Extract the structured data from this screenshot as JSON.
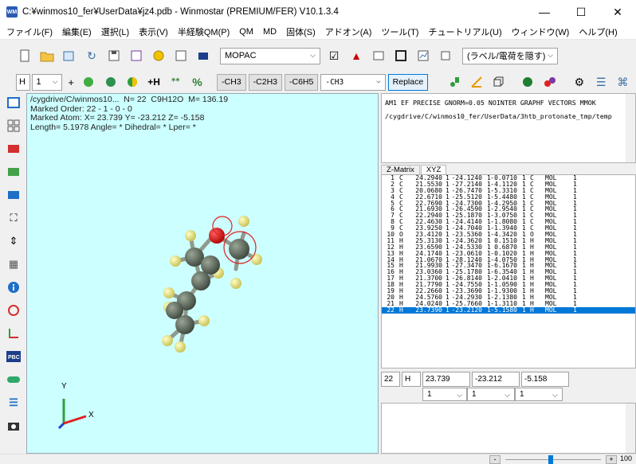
{
  "window": {
    "title": "C:¥winmos10_fer¥UserData¥jz4.pdb - Winmostar (PREMIUM/FER) V10.1.3.4",
    "logo": "WM",
    "minimize": "—",
    "maximize": "☐",
    "close": "✕"
  },
  "menu": [
    "ファイル(F)",
    "編集(E)",
    "選択(L)",
    "表示(V)",
    "半経験QM(P)",
    "QM",
    "MD",
    "固体(S)",
    "アドオン(A)",
    "ツール(T)",
    "チュートリアル(U)",
    "ウィンドウ(W)",
    "ヘルプ(H)"
  ],
  "toolbar1": {
    "method_select": "MOPAC",
    "label_select": "(ラベル/電荷を隠す)"
  },
  "toolbar2": {
    "element_select": "H",
    "count_select": "1",
    "plus_label": "+",
    "h_label": "+H",
    "percent_label": "%",
    "btn_ch3": "-CH3",
    "btn_c2h3": "-C2H3",
    "btn_c6h5": "-C6H5",
    "fragment_select": "-CH3",
    "replace_button": "Replace"
  },
  "viewer": {
    "line1": "/cygdrive/C/winmos10...  N= 22  C9H12O  M= 136.19",
    "line2": "Marked Order: 22 - 1 - 0 - 0",
    "line3": "Marked Atom: X= 23.739 Y= -23.212 Z= -5.158",
    "line4": "Length= 5.1978 Angle= * Dihedral= * Lper= *",
    "axis_y": "Y",
    "axis_x": "X"
  },
  "keywords": {
    "line1": "AM1 EF PRECISE GNORM=0.05 NOINTER GRAPHF VECTORS MMOK",
    "line2": "/cygdrive/C/winmos10_fer/UserData/3htb_protonate_tmp/temp"
  },
  "tabs": [
    "Z-Matrix",
    "XYZ"
  ],
  "xyz_rows": [
    [
      "1",
      "C",
      "24.2940",
      "1",
      "-24.1240",
      "1",
      "-0.0710",
      "1",
      "C",
      "MOL",
      "1"
    ],
    [
      "2",
      "C",
      "21.5530",
      "1",
      "-27.2140",
      "1",
      "-4.1120",
      "1",
      "C",
      "MOL",
      "1"
    ],
    [
      "3",
      "C",
      "20.0680",
      "1",
      "-26.7470",
      "1",
      "-5.3310",
      "1",
      "C",
      "MOL",
      "1"
    ],
    [
      "4",
      "C",
      "22.6710",
      "1",
      "-25.5120",
      "1",
      "-5.4480",
      "1",
      "C",
      "MOL",
      "1"
    ],
    [
      "5",
      "C",
      "22.7690",
      "1",
      "-24.7300",
      "1",
      "-4.2950",
      "1",
      "C",
      "MOL",
      "1"
    ],
    [
      "6",
      "C",
      "21.6930",
      "1",
      "-26.4590",
      "1",
      "-2.9540",
      "1",
      "C",
      "MOL",
      "1"
    ],
    [
      "7",
      "C",
      "22.2940",
      "1",
      "-25.1870",
      "1",
      "-3.0750",
      "1",
      "C",
      "MOL",
      "1"
    ],
    [
      "8",
      "C",
      "22.4630",
      "1",
      "-24.4140",
      "1",
      "-1.8080",
      "1",
      "C",
      "MOL",
      "1"
    ],
    [
      "9",
      "C",
      "23.9250",
      "1",
      "-24.7040",
      "1",
      "-1.3940",
      "1",
      "C",
      "MOL",
      "1"
    ],
    [
      "10",
      "O",
      "23.4120",
      "1",
      "-23.5360",
      "1",
      "-4.3420",
      "1",
      "O",
      "MOL",
      "1"
    ],
    [
      "11",
      "H",
      "25.3130",
      "1",
      "-24.3620",
      "1",
      "0.1510",
      "1",
      "H",
      "MOL",
      "1"
    ],
    [
      "12",
      "H",
      "23.6590",
      "1",
      "-24.5330",
      "1",
      "0.6870",
      "1",
      "H",
      "MOL",
      "1"
    ],
    [
      "13",
      "H",
      "24.1740",
      "1",
      "-23.0610",
      "1",
      "-0.1020",
      "1",
      "H",
      "MOL",
      "1"
    ],
    [
      "14",
      "H",
      "21.0670",
      "1",
      "-28.1240",
      "1",
      "-4.0750",
      "1",
      "H",
      "MOL",
      "1"
    ],
    [
      "15",
      "H",
      "21.9930",
      "1",
      "-27.3470",
      "1",
      "-6.1670",
      "1",
      "H",
      "MOL",
      "1"
    ],
    [
      "16",
      "H",
      "23.0360",
      "1",
      "-25.1780",
      "1",
      "-6.3540",
      "1",
      "H",
      "MOL",
      "1"
    ],
    [
      "17",
      "H",
      "21.3700",
      "1",
      "-26.8140",
      "1",
      "-2.0410",
      "1",
      "H",
      "MOL",
      "1"
    ],
    [
      "18",
      "H",
      "21.7790",
      "1",
      "-24.7550",
      "1",
      "-1.0590",
      "1",
      "H",
      "MOL",
      "1"
    ],
    [
      "19",
      "H",
      "22.2660",
      "1",
      "-23.3690",
      "1",
      "-1.9300",
      "1",
      "H",
      "MOL",
      "1"
    ],
    [
      "20",
      "H",
      "24.5760",
      "1",
      "-24.2930",
      "1",
      "-2.1380",
      "1",
      "H",
      "MOL",
      "1"
    ],
    [
      "21",
      "H",
      "24.0240",
      "1",
      "-25.7660",
      "1",
      "-1.3110",
      "1",
      "H",
      "MOL",
      "1"
    ],
    [
      "22",
      "H",
      "23.7390",
      "1",
      "-23.2120",
      "1",
      "-5.1580",
      "1",
      "H",
      "MOL",
      "1"
    ]
  ],
  "edit": {
    "index": "22",
    "element": "H",
    "x": "23.739",
    "y": "-23.212",
    "z": "-5.158",
    "flag1": "1",
    "flag2": "1",
    "flag3": "1"
  },
  "status": {
    "minus": "-",
    "plus": "+",
    "zoom": "100"
  }
}
